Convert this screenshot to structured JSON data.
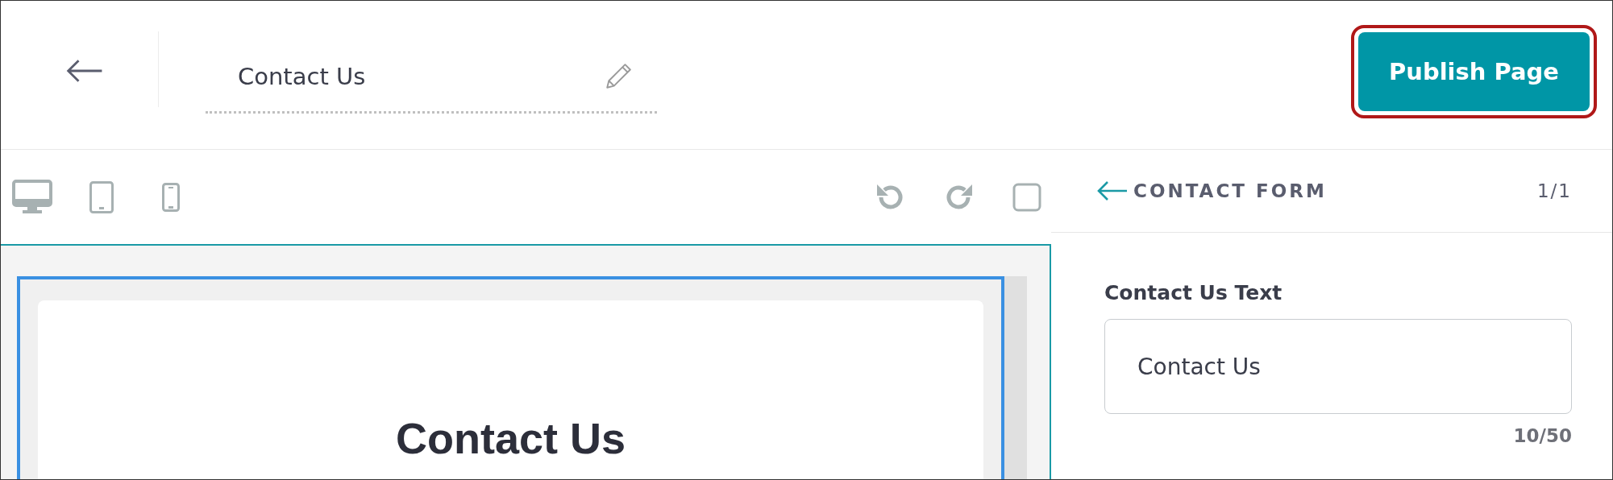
{
  "header": {
    "page_title": {
      "value": "Contact Us"
    },
    "publish_button": {
      "label": "Publish Page"
    }
  },
  "canvas": {
    "heading": "Contact Us"
  },
  "panel": {
    "title": "CONTACT FORM",
    "pager": "1/1",
    "fields": [
      {
        "label": "Contact Us Text",
        "value": "Contact Us",
        "counter": "10/50"
      }
    ]
  }
}
